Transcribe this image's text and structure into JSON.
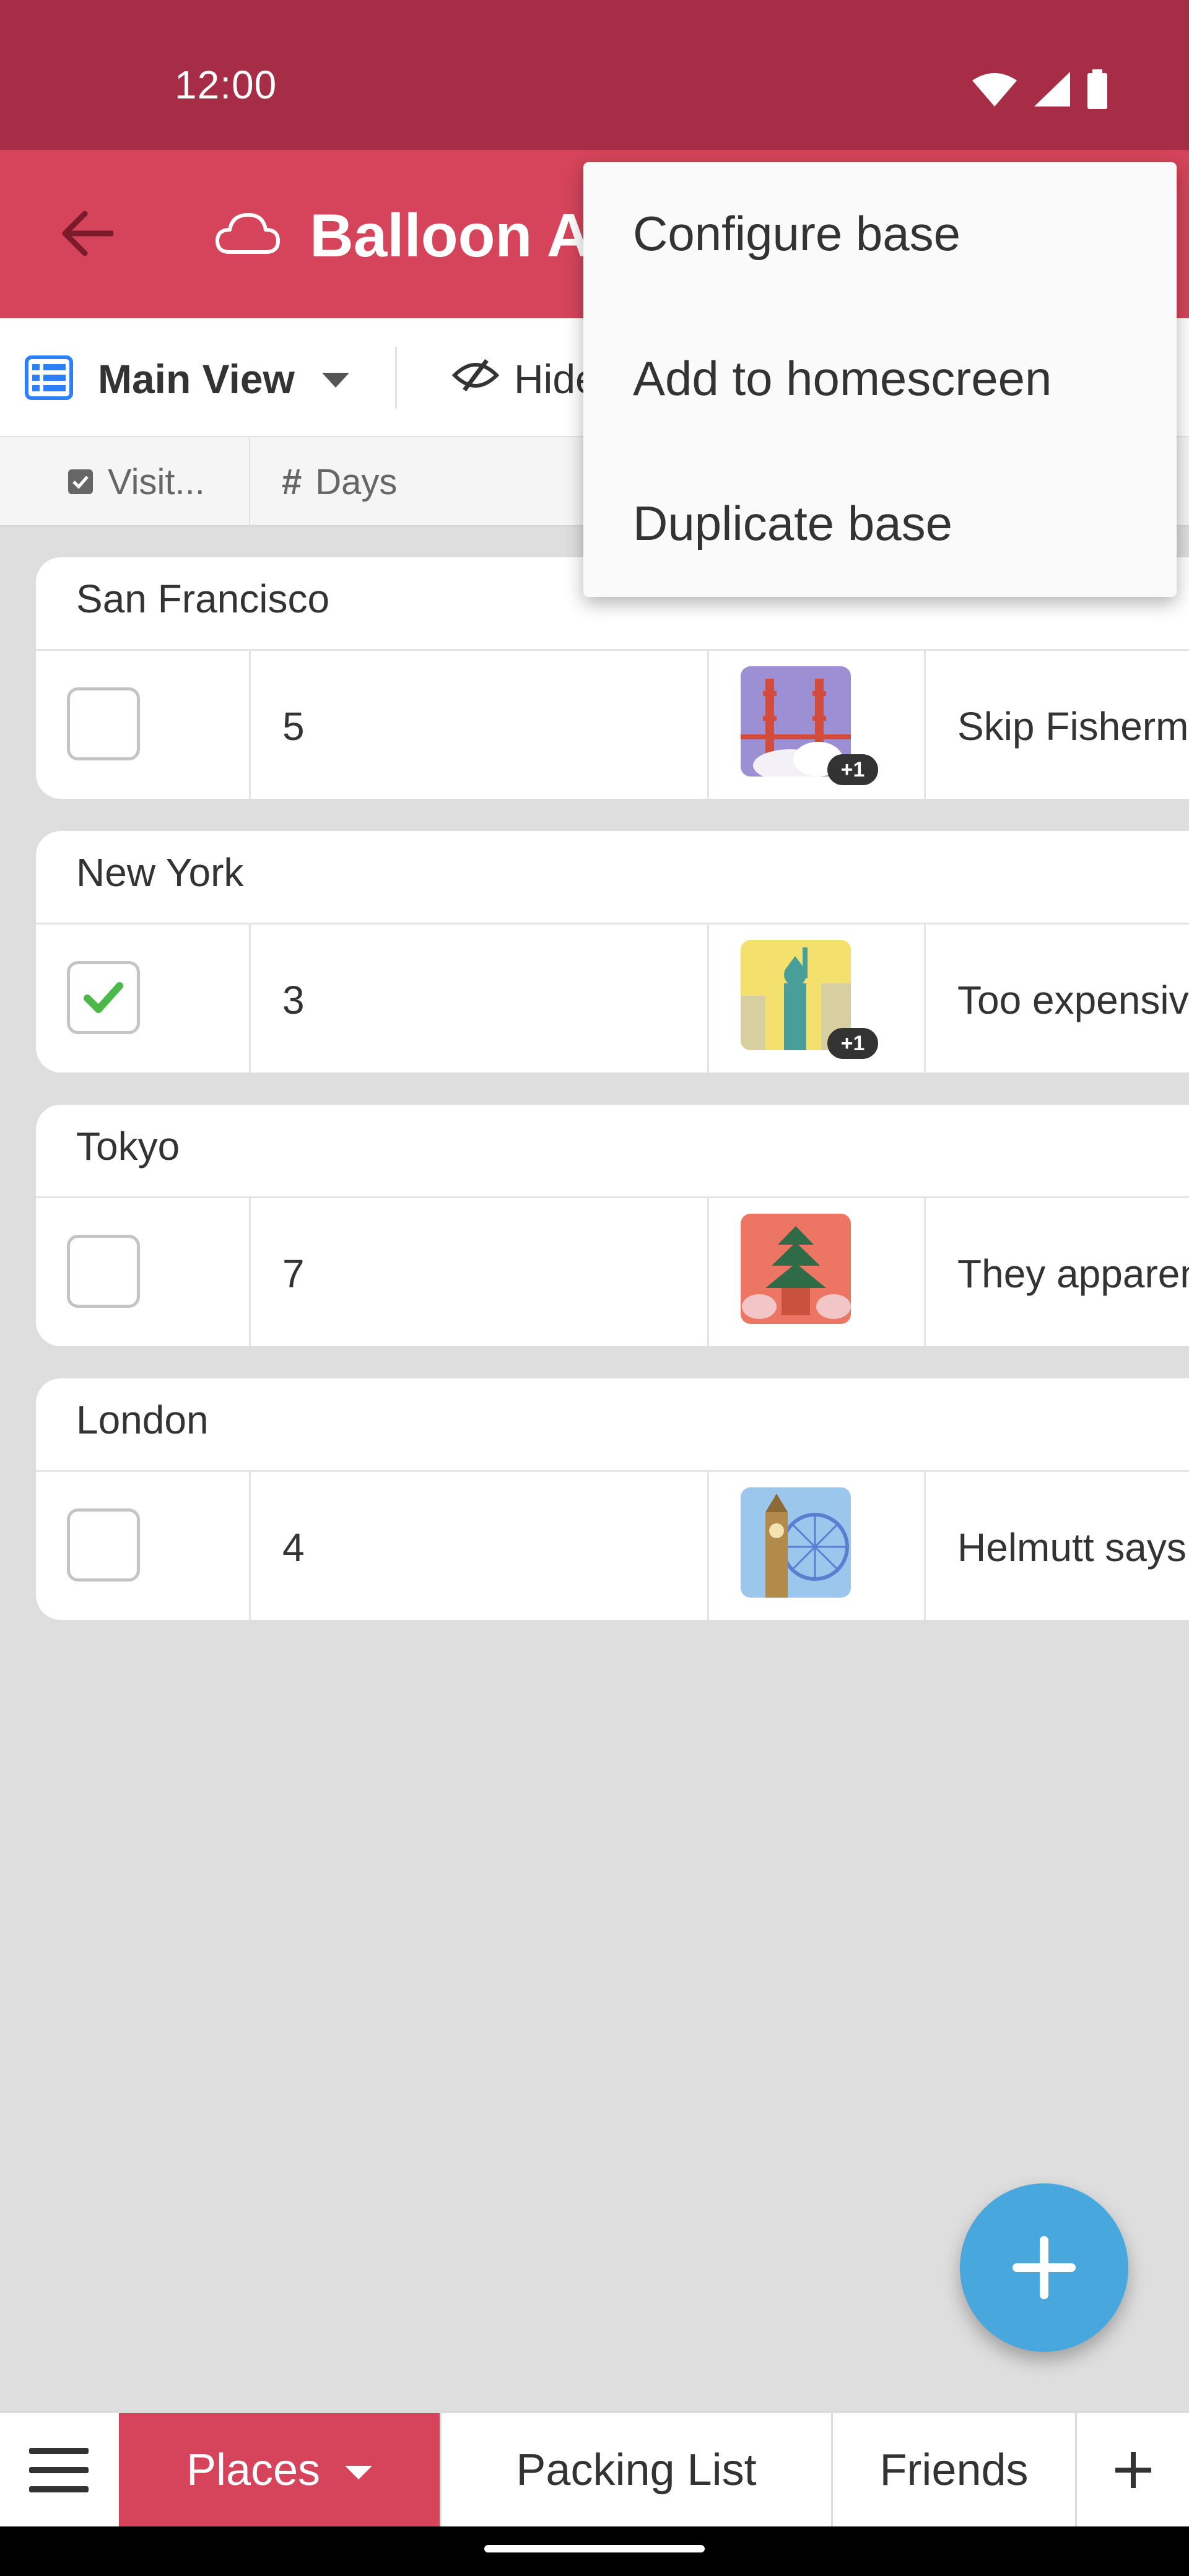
{
  "status_bar": {
    "time": "12:00"
  },
  "app_bar": {
    "title": "Balloon Ac"
  },
  "toolbar": {
    "view_label": "Main View",
    "hide_label": "Hide"
  },
  "columns": {
    "visited": "Visit...",
    "days": "Days"
  },
  "records": [
    {
      "group": "San Francisco",
      "visited": false,
      "days": "5",
      "image_extra": "+1",
      "notes": "Skip Fisherm"
    },
    {
      "group": "New York",
      "visited": true,
      "days": "3",
      "image_extra": "+1",
      "notes": "Too expensiv"
    },
    {
      "group": "Tokyo",
      "visited": false,
      "days": "7",
      "image_extra": "",
      "notes": "They apparen"
    },
    {
      "group": "London",
      "visited": false,
      "days": "4",
      "image_extra": "",
      "notes": "Helmutt says"
    }
  ],
  "tabs": {
    "active": "Places",
    "items": [
      "Packing List",
      "Friends"
    ]
  },
  "overflow_menu": {
    "items": [
      "Configure base",
      "Add to homescreen",
      "Duplicate base"
    ]
  },
  "colors": {
    "status_bar": "#a72d46",
    "app_bar": "#d5445a",
    "fab": "#48a7dc",
    "check": "#4cb84a"
  },
  "icons": [
    "wifi-icon",
    "signal-icon",
    "battery-icon",
    "back-arrow-icon",
    "cloud-icon",
    "grid-view-icon",
    "hide-fields-icon",
    "checkbox-field-icon",
    "number-field-icon",
    "add-icon",
    "hamburger-menu-icon"
  ]
}
